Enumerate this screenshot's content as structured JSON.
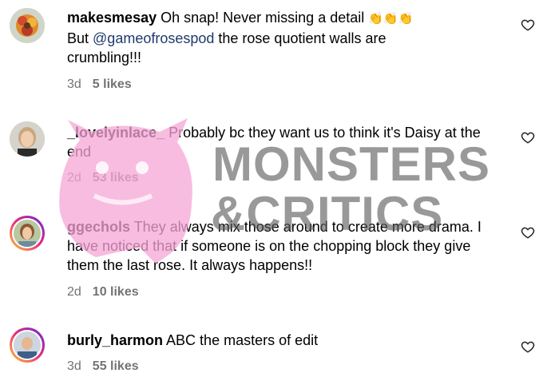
{
  "comments": [
    {
      "username": "makesmesay",
      "text_before": " Oh snap! Never missing a detail ",
      "emoji": "👏👏👏",
      "line2_mention": "@gameofrosespod",
      "line2_rest": " the rose quotient walls are",
      "line3": "crumbling!!!",
      "prefix_but": "But ",
      "time": "3d",
      "likes": "5 likes"
    },
    {
      "username": "_lovelyinlace_",
      "text": " Probably bc they want us to think it's Daisy at the end",
      "time": "2d",
      "likes": "53 likes"
    },
    {
      "username": "ggechols",
      "text": " They always mix those around to create more drama. I have noticed that if someone is on the chopping block they give them the last rose. It always happens!!",
      "time": "2d",
      "likes": "10 likes"
    },
    {
      "username": "burly_harmon",
      "text": " ABC the masters of edit",
      "time": "3d",
      "likes": "55 likes"
    }
  ],
  "watermark": {
    "line1": "MONSTERS",
    "line2": "&CRITICS"
  },
  "colors": {
    "meta": "#737373",
    "mention": "#1f3a6e",
    "watermark_pink": "#f6a6d6"
  }
}
